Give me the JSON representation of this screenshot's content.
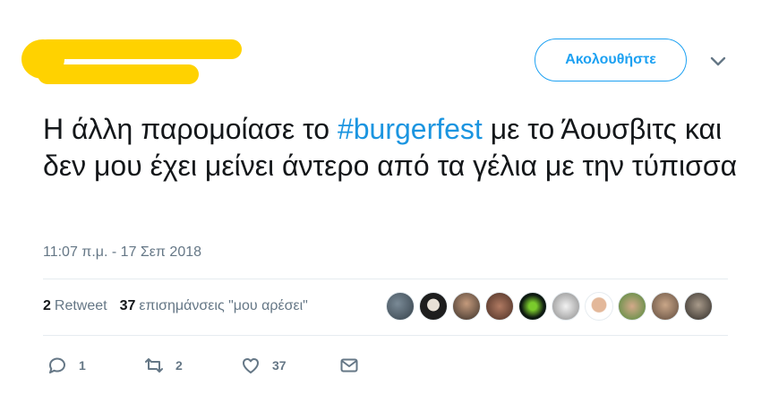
{
  "header": {
    "follow_label": "Ακολουθήστε",
    "accent_color": "#1da1f2",
    "redaction_color": "#ffd200"
  },
  "tweet": {
    "text_before": "Η άλλη παρομοίασε το ",
    "hashtag": "#burgerfest",
    "text_after": " με το Άουσβιτς και δεν μου έχει μείνει άντερο από τα γέλια με την τύπισσα",
    "timestamp": "11:07 π.μ. - 17 Σεπ 2018"
  },
  "stats": {
    "retweet_count": "2",
    "retweet_label": "Retweet",
    "likes_count": "37",
    "likes_label": "επισημάνσεις \"μου αρέσει\""
  },
  "actions": {
    "reply_count": "1",
    "retweet_count": "2",
    "like_count": "37"
  },
  "icons": [
    "chevron-down-icon",
    "reply-icon",
    "retweet-icon",
    "heart-icon",
    "message-icon"
  ]
}
